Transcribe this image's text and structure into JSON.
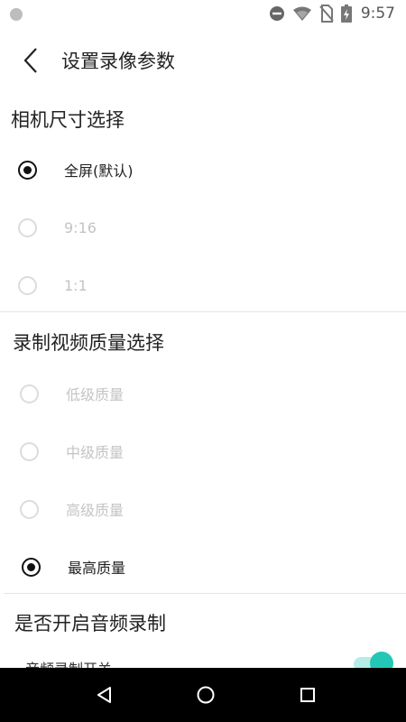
{
  "status_bar": {
    "time": "9:57",
    "icons": [
      "dnd-icon",
      "wifi-icon",
      "no-sim-icon",
      "battery-charging-icon"
    ]
  },
  "app_bar": {
    "back_icon": "chevron-left-icon",
    "title": "设置录像参数"
  },
  "camera_size": {
    "title": "相机尺寸选择",
    "options": [
      {
        "label": "全屏(默认)",
        "checked": true,
        "enabled": true
      },
      {
        "label": "9:16",
        "checked": false,
        "enabled": false
      },
      {
        "label": "1:1",
        "checked": false,
        "enabled": false
      }
    ]
  },
  "video_quality": {
    "title": "录制视频质量选择",
    "options": [
      {
        "label": "低级质量",
        "checked": false,
        "enabled": false
      },
      {
        "label": "中级质量",
        "checked": false,
        "enabled": false
      },
      {
        "label": "高级质量",
        "checked": false,
        "enabled": false
      },
      {
        "label": "最高质量",
        "checked": true,
        "enabled": true
      }
    ]
  },
  "audio": {
    "title": "是否开启音频录制",
    "switch_label": "音频录制开关",
    "switch_on": true,
    "accent_color": "#24c7b6"
  },
  "nav_bar": {
    "buttons": [
      "back-triangle-icon",
      "home-circle-icon",
      "recents-square-icon"
    ]
  }
}
